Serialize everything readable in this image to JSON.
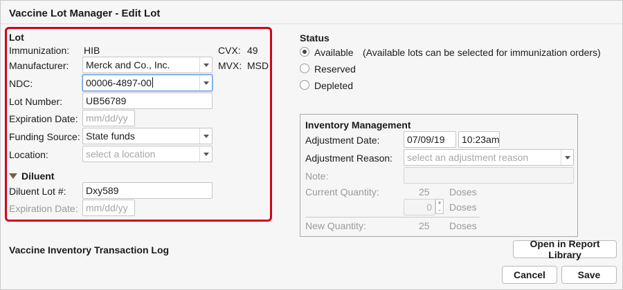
{
  "window": {
    "title": "Vaccine Lot Manager - Edit Lot"
  },
  "lot": {
    "heading": "Lot",
    "immunization_label": "Immunization:",
    "immunization_value": "HIB",
    "cvx_label": "CVX:",
    "cvx_value": "49",
    "manufacturer_label": "Manufacturer:",
    "manufacturer_value": "Merck and Co., Inc.",
    "mvx_label": "MVX:",
    "mvx_value": "MSD",
    "ndc_label": "NDC:",
    "ndc_value": "00006-4897-00",
    "lot_number_label": "Lot Number:",
    "lot_number_value": "UB56789",
    "expiration_label": "Expiration Date:",
    "expiration_placeholder": "mm/dd/yy",
    "funding_label": "Funding Source:",
    "funding_value": "State funds",
    "location_label": "Location:",
    "location_placeholder": "select a location"
  },
  "diluent": {
    "heading": "Diluent",
    "lot_label": "Diluent Lot #:",
    "lot_value": "Dxy589",
    "expiration_label": "Expiration Date:",
    "expiration_placeholder": "mm/dd/yy"
  },
  "status": {
    "heading": "Status",
    "options": [
      {
        "label": "Available",
        "checked": true
      },
      {
        "label": "Reserved",
        "checked": false
      },
      {
        "label": "Depleted",
        "checked": false
      }
    ],
    "available_note": "(Available lots can be selected for immunization orders)"
  },
  "inventory": {
    "heading": "Inventory Management",
    "adjustment_date_label": "Adjustment Date:",
    "adjustment_date_value": "07/09/19",
    "adjustment_time_value": "10:23am",
    "adjustment_reason_label": "Adjustment Reason:",
    "adjustment_reason_placeholder": "select an adjustment reason",
    "note_label": "Note:",
    "current_quantity_label": "Current Quantity:",
    "current_quantity_value": "25",
    "doses_unit": "Doses",
    "adjust_value": "0",
    "stepper_plus": "+",
    "stepper_minus": "-",
    "new_quantity_label": "New Quantity:",
    "new_quantity_value": "25"
  },
  "transaction_log": {
    "heading": "Vaccine Inventory Transaction Log",
    "open_report_label": "Open in Report Library"
  },
  "actions": {
    "cancel_label": "Cancel",
    "save_label": "Save"
  }
}
